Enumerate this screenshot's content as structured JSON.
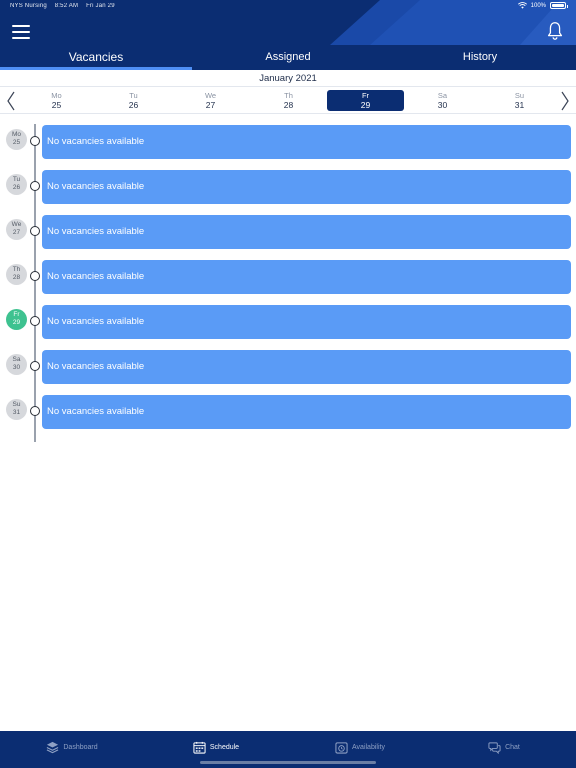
{
  "status_bar": {
    "carrier": "NYS Nursing",
    "time": "8:52 AM",
    "date": "Fri Jan 29",
    "battery": "100%"
  },
  "header": {
    "tabs": [
      {
        "label": "Vacancies"
      },
      {
        "label": "Assigned"
      },
      {
        "label": "History"
      }
    ]
  },
  "week": {
    "month_label": "January 2021",
    "days": [
      {
        "name": "Mo",
        "date": "25"
      },
      {
        "name": "Tu",
        "date": "26"
      },
      {
        "name": "We",
        "date": "27"
      },
      {
        "name": "Th",
        "date": "28"
      },
      {
        "name": "Fr",
        "date": "29"
      },
      {
        "name": "Sa",
        "date": "30"
      },
      {
        "name": "Su",
        "date": "31"
      }
    ]
  },
  "timeline": {
    "rows": [
      {
        "day": "Mo",
        "date": "25",
        "message": "No vacancies available"
      },
      {
        "day": "Tu",
        "date": "26",
        "message": "No vacancies available"
      },
      {
        "day": "We",
        "date": "27",
        "message": "No vacancies available"
      },
      {
        "day": "Th",
        "date": "28",
        "message": "No vacancies available"
      },
      {
        "day": "Fr",
        "date": "29",
        "message": "No vacancies available"
      },
      {
        "day": "Sa",
        "date": "30",
        "message": "No vacancies available"
      },
      {
        "day": "Su",
        "date": "31",
        "message": "No vacancies available"
      }
    ]
  },
  "bottom_nav": {
    "items": [
      {
        "label": "Dashboard",
        "icon": "layers-icon"
      },
      {
        "label": "Schedule",
        "icon": "calendar-icon"
      },
      {
        "label": "Availability",
        "icon": "calendar-clock-icon"
      },
      {
        "label": "Chat",
        "icon": "chat-icon"
      }
    ]
  },
  "colors": {
    "header": "#0b2d72",
    "accent": "#4f8ff5",
    "card": "#5a9bf6",
    "today": "#3ec290"
  }
}
